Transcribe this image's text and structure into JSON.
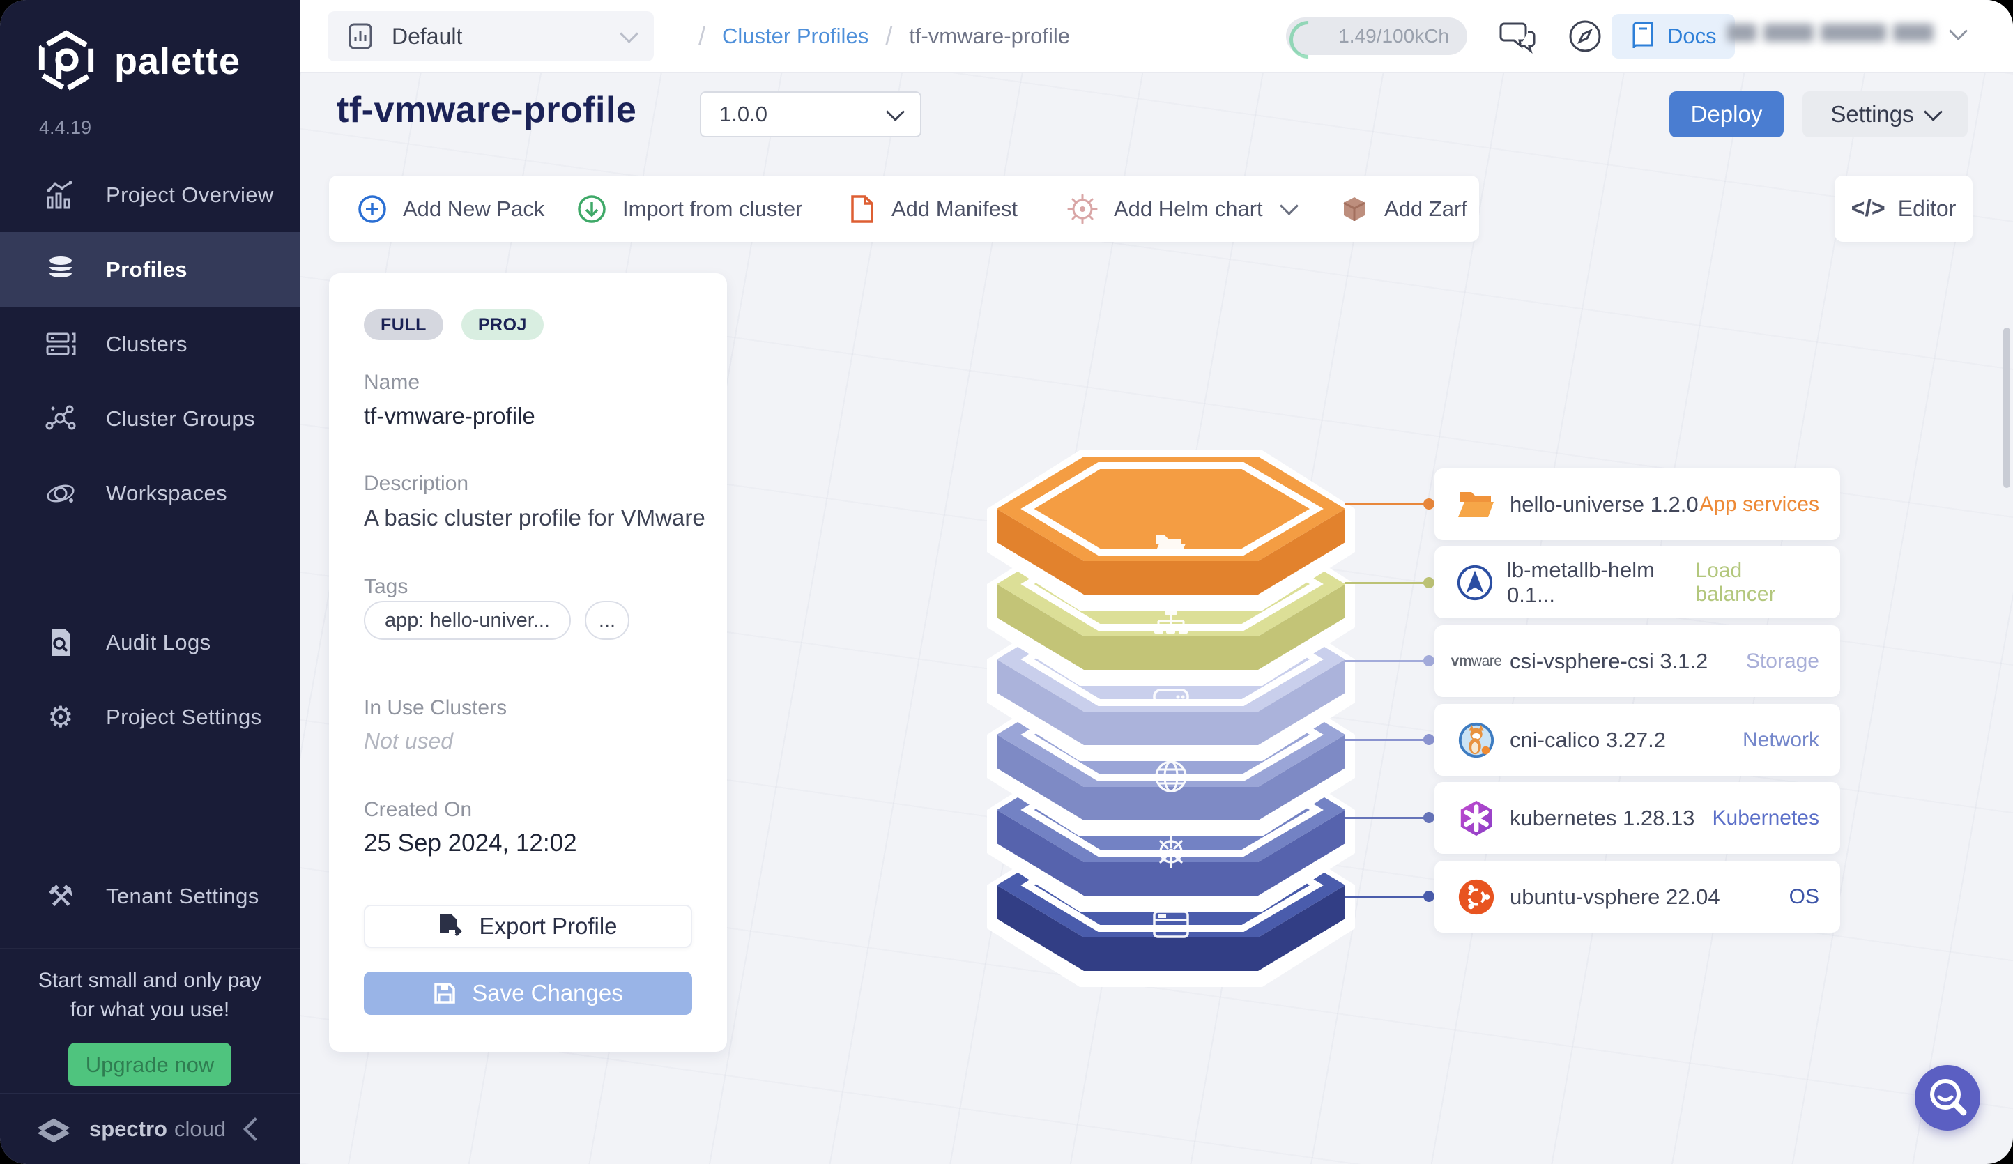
{
  "sidebar": {
    "brand": "palette",
    "version": "4.4.19",
    "items": [
      {
        "label": "Project Overview",
        "icon": "chart-icon",
        "selected": false
      },
      {
        "label": "Profiles",
        "icon": "layers-icon",
        "selected": true
      },
      {
        "label": "Clusters",
        "icon": "server-icon",
        "selected": false
      },
      {
        "label": "Cluster Groups",
        "icon": "nodes-icon",
        "selected": false
      },
      {
        "label": "Workspaces",
        "icon": "orbit-icon",
        "selected": false
      },
      {
        "label": "Audit Logs",
        "icon": "audit-doc-icon",
        "selected": false
      },
      {
        "label": "Project Settings",
        "icon": "gear-icon",
        "selected": false
      },
      {
        "label": "Tenant Settings",
        "icon": "tools-icon",
        "selected": false
      }
    ],
    "upgrade": {
      "line1": "Start small and only pay",
      "line2": "for what you use!",
      "button": "Upgrade now"
    },
    "footer": {
      "brand_primary": "spectro",
      "brand_secondary": "cloud"
    }
  },
  "topbar": {
    "project_selector": "Default",
    "breadcrumb": {
      "separator": "/",
      "parent": "Cluster Profiles",
      "current": "tf-vmware-profile"
    },
    "usage": "1.49/100kCh",
    "docs": "Docs"
  },
  "header": {
    "title": "tf-vmware-profile",
    "version": "1.0.0",
    "deploy": "Deploy",
    "settings": "Settings"
  },
  "toolbar": {
    "add_new_pack": "Add New Pack",
    "import_from_cluster": "Import from cluster",
    "add_manifest": "Add Manifest",
    "add_helm_chart": "Add Helm chart",
    "add_zarf": "Add Zarf",
    "editor": "Editor"
  },
  "profile_card": {
    "badge_full": "FULL",
    "badge_proj": "PROJ",
    "name_label": "Name",
    "name": "tf-vmware-profile",
    "description_label": "Description",
    "description": "A basic cluster profile for VMware",
    "tags_label": "Tags",
    "tag_1": "app: hello-univer...",
    "tag_more": "...",
    "in_use_label": "In Use Clusters",
    "in_use": "Not used",
    "created_label": "Created On",
    "created": "25 Sep 2024, 12:02",
    "export_button": "Export Profile",
    "save_button": "Save Changes"
  },
  "packs": {
    "rows": [
      {
        "name": "hello-universe 1.2.0",
        "category": "App services",
        "category_color": "#ED8936",
        "icon": "folder-open-icon"
      },
      {
        "name": "lb-metallb-helm 0.1...",
        "category": "Load balancer",
        "category_color": "#B3C77D",
        "icon": "metallb-icon"
      },
      {
        "name": "csi-vsphere-csi 3.1.2",
        "category": "Storage",
        "category_color": "#A9AFD8",
        "icon": "vmware-icon",
        "icon_label": "vmware"
      },
      {
        "name": "cni-calico 3.27.2",
        "category": "Network",
        "category_color": "#7487CB",
        "icon": "calico-icon"
      },
      {
        "name": "kubernetes 1.28.13",
        "category": "Kubernetes",
        "category_color": "#5B6FC8",
        "icon": "kubernetes-icon"
      },
      {
        "name": "ubuntu-vsphere 22.04",
        "category": "OS",
        "category_color": "#3D55A8",
        "icon": "ubuntu-icon"
      }
    ]
  },
  "hexstack": {
    "layers": [
      {
        "layer": "App services",
        "top": "#F49D43",
        "side": "#E2822D",
        "line": "#E8873B"
      },
      {
        "layer": "Load balancer",
        "top": "#DCDF97",
        "side": "#C3C477",
        "line": "#BCC275"
      },
      {
        "layer": "Storage",
        "top": "#C9CFEC",
        "side": "#ABB3DB",
        "line": "#A3ABDA"
      },
      {
        "layer": "Network",
        "top": "#9AA5D7",
        "side": "#7E8AC5",
        "line": "#8A93CF"
      },
      {
        "layer": "Kubernetes",
        "top": "#7382C4",
        "side": "#5663AD",
        "line": "#6674B9"
      },
      {
        "layer": "OS",
        "top": "#4A5CAC",
        "side": "#323E85",
        "line": "#4A5CAB"
      }
    ]
  },
  "colors": {
    "accent_blue": "#4A7DD1",
    "sidebar_bg": "#191C37",
    "upgrade_green": "#4FC47E",
    "fab_purple": "#5B5FC2"
  }
}
